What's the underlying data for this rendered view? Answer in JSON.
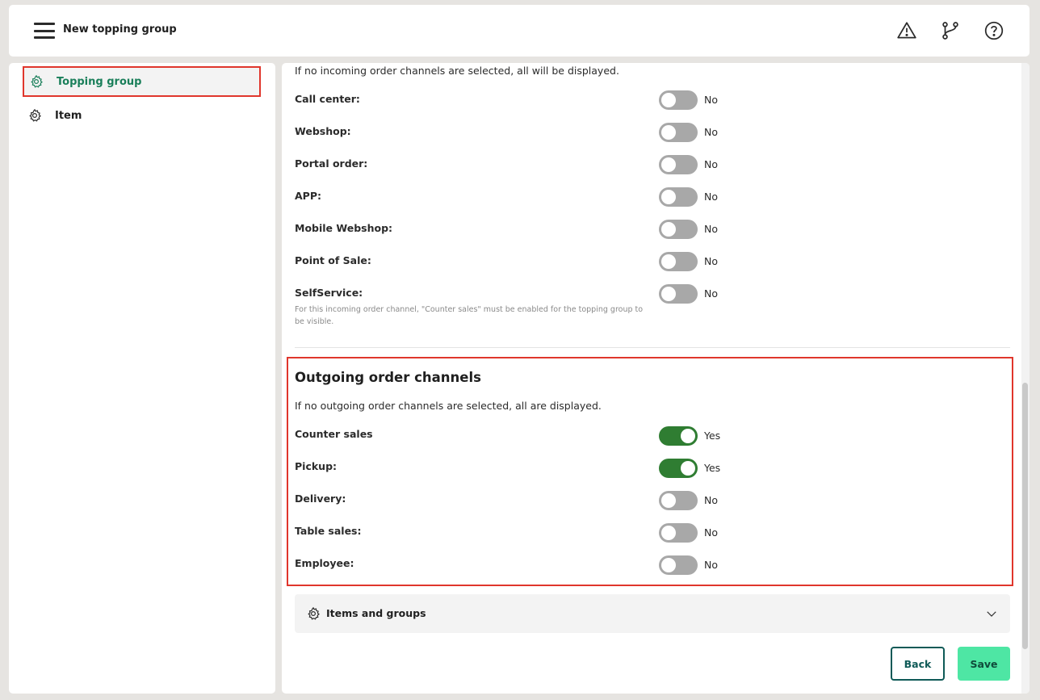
{
  "header": {
    "title": "New topping group",
    "icons": [
      "warning-icon",
      "branch-icon",
      "help-icon"
    ]
  },
  "sidebar": {
    "items": [
      {
        "label": "Topping group",
        "icon": "gear-icon",
        "active": true
      },
      {
        "label": "Item",
        "icon": "gear-icon",
        "active": false
      }
    ]
  },
  "incoming": {
    "description": "If no incoming order channels are selected, all will be displayed.",
    "channels": [
      {
        "label": "Call center:",
        "state": "No"
      },
      {
        "label": "Webshop:",
        "state": "No"
      },
      {
        "label": "Portal order:",
        "state": "No"
      },
      {
        "label": "APP:",
        "state": "No"
      },
      {
        "label": "Mobile Webshop:",
        "state": "No"
      },
      {
        "label": "Point of Sale:",
        "state": "No"
      },
      {
        "label": "SelfService:",
        "state": "No"
      }
    ],
    "selfservice_note": "For this incoming order channel, \"Counter sales\" must be enabled for the topping group to be visible."
  },
  "outgoing": {
    "title": "Outgoing order channels",
    "description": "If no outgoing order channels are selected, all are displayed.",
    "channels": [
      {
        "label": "Counter sales",
        "state": "Yes"
      },
      {
        "label": "Pickup:",
        "state": "Yes"
      },
      {
        "label": "Delivery:",
        "state": "No"
      },
      {
        "label": "Table sales:",
        "state": "No"
      },
      {
        "label": "Employee:",
        "state": "No"
      }
    ]
  },
  "accordion": {
    "label": "Items and groups",
    "icon": "gear-icon"
  },
  "buttons": {
    "back": "Back",
    "save": "Save"
  },
  "colors": {
    "toggle_on": "#2f7d32",
    "toggle_off": "#a8a8a8",
    "accent": "#1a7f5a",
    "highlight": "#e0362c",
    "save": "#4ee6a4"
  }
}
